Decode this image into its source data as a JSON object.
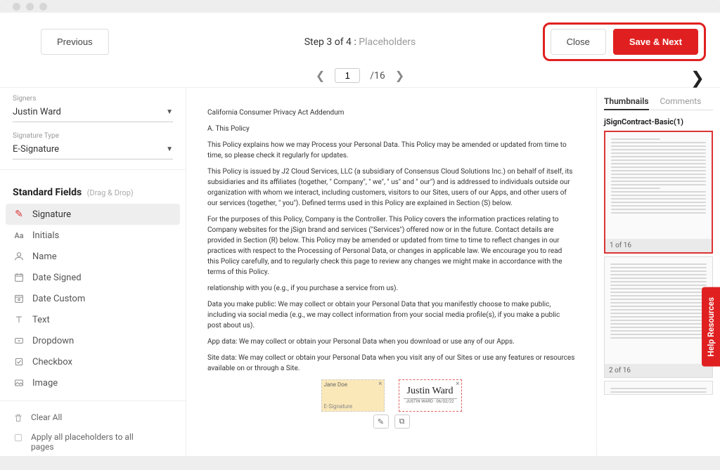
{
  "header": {
    "prev_label": "Previous",
    "step_prefix": "Step 3 of 4 :",
    "step_name": "Placeholders",
    "close_label": "Close",
    "save_label": "Save & Next"
  },
  "pager": {
    "current": "1",
    "total": "/16"
  },
  "sidebar": {
    "signers_label": "Signers",
    "signer_value": "Justin Ward",
    "sigtype_label": "Signature Type",
    "sigtype_value": "E-Signature",
    "fields_title": "Standard Fields",
    "fields_hint": "(Drag & Drop)",
    "fields": [
      {
        "label": "Signature",
        "icon": "signature"
      },
      {
        "label": "Initials",
        "icon": "initials"
      },
      {
        "label": "Name",
        "icon": "name"
      },
      {
        "label": "Date Signed",
        "icon": "date-signed"
      },
      {
        "label": "Date Custom",
        "icon": "date-custom"
      },
      {
        "label": "Text",
        "icon": "text"
      },
      {
        "label": "Dropdown",
        "icon": "dropdown"
      },
      {
        "label": "Checkbox",
        "icon": "checkbox"
      },
      {
        "label": "Image",
        "icon": "image"
      }
    ],
    "clear_label": "Clear All",
    "apply_label": "Apply all placeholders to all pages"
  },
  "document": {
    "title": "California Consumer Privacy Act Addendum",
    "sec_a": "A. This Policy",
    "p1": "This Policy explains how we may Process your Personal Data. This Policy may be amended or updated from time to time, so please check it regularly for updates.",
    "p2": "This Policy is issued by J2 Cloud Services, LLC (a subsidiary of Consensus Cloud Solutions Inc.) on behalf of itself, its subsidiaries and its affiliates (together, \" Company\", \" we\", \" us\" and \" our\") and is addressed to individuals outside our organization with whom we interact, including customers, visitors to our Sites, users of our Apps, and other users of our services (together, \" you\"). Defined terms used in this Policy are explained in Section (S) below.",
    "p3": "For the purposes of this Policy, Company is the Controller. This Policy covers the information practices relating to Company websites for the jSign brand and services (\"Services\") offered now or in the future. Contact details are provided in Section (R) below. This Policy may be amended or updated from time to time to reflect changes in our practices with respect to the Processing of Personal Data, or changes in applicable law. We encourage you to read this Policy carefully, and to regularly check this page to review any changes we might make in accordance with the terms of this Policy.",
    "p4": "relationship with you (e.g., if you purchase a service from us).",
    "p5": "Data you make public: We may collect or obtain your Personal Data that you manifestly choose to make public, including via social media (e.g., we may collect information from your social media profile(s), if you make a public post about us).",
    "p6": "App data: We may collect or obtain your Personal Data when you download or use any of our Apps.",
    "p7": "Site data: We may collect or obtain your Personal Data when you visit any of our Sites or use any features or resources available on or through a Site.",
    "sig1_name": "Jane Doe",
    "sig1_type": "E-Signature",
    "sig2_script": "Justin Ward",
    "sig2_sub": "JUSTIN WARD · 06/02/22"
  },
  "thumbs": {
    "tab1": "Thumbnails",
    "tab2": "Comments",
    "filename": "jSignContract-Basic(1)",
    "cap1": "1 of 16",
    "cap2": "2 of 16"
  },
  "help_label": "Help Resources"
}
